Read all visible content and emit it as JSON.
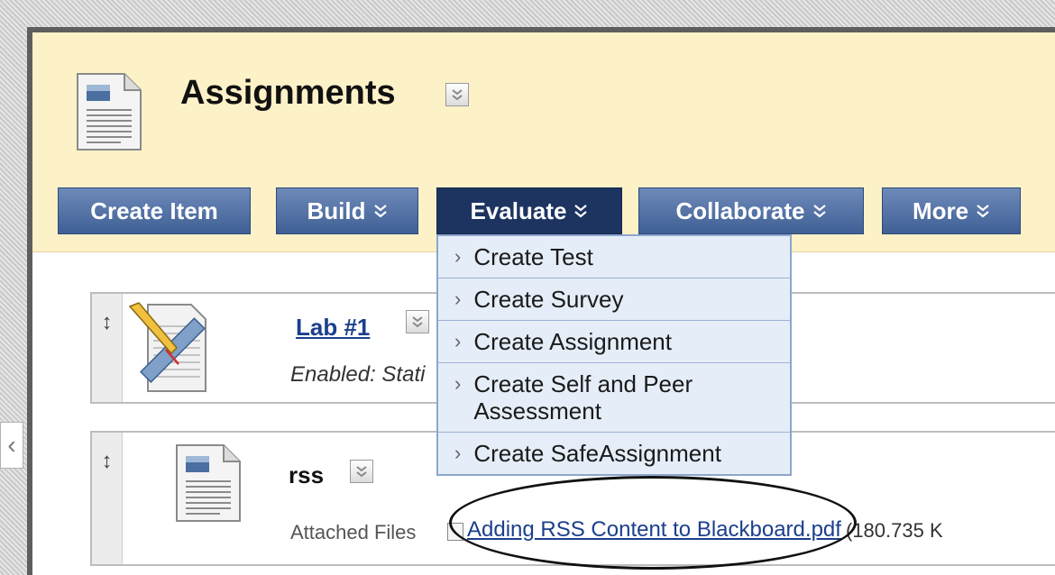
{
  "page": {
    "title": "Assignments"
  },
  "toolbar": {
    "create_item": "Create Item",
    "build": "Build",
    "evaluate": "Evaluate",
    "collaborate": "Collaborate",
    "more": "More"
  },
  "evaluate_menu": {
    "items": [
      {
        "label": "Create Test"
      },
      {
        "label": "Create Survey"
      },
      {
        "label": "Create Assignment"
      },
      {
        "label": "Create Self and Peer Assessment"
      },
      {
        "label": "Create SafeAssignment"
      }
    ]
  },
  "content_items": [
    {
      "title": "Lab #1",
      "status": "Enabled: Stati"
    },
    {
      "title": "rss",
      "attached_label": "Attached Files",
      "file_name": "Adding RSS Content to Blackboard.pdf",
      "file_size": "(180.735 K"
    }
  ],
  "icons": {
    "document": "document-icon",
    "assignment": "assignment-ruler-icon",
    "chevron": "double-chevron-down-icon",
    "drag": "drag-handle-icon"
  },
  "colors": {
    "header_bg": "#fdf1c8",
    "button_bg": "#4f6fa5",
    "button_active": "#1d3461",
    "menu_bg": "#e5edf8",
    "link": "#1b3f8b"
  }
}
